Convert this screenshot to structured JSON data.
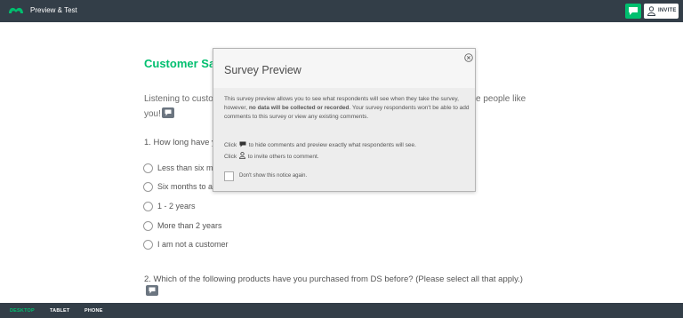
{
  "topbar": {
    "logo_icon": "surveymonkey-logo",
    "title": "Preview & Test",
    "comment_icon": "comment-icon",
    "invite_label": "INVITE"
  },
  "survey": {
    "title": "Customer Sat",
    "intro_left": "Listening to custom",
    "intro_right": "e people like",
    "intro_end": "you!",
    "question1": "1. How long have y",
    "options": [
      "Less than six mo",
      "Six months to a",
      "1 - 2 years",
      "More than 2 years",
      "I am not a customer"
    ],
    "question2": "2. Which of the following products have you purchased from DS before? (Please select all that apply.)"
  },
  "modal": {
    "title": "Survey Preview",
    "body_part1": "This survey preview allows you to see what respondents will see when they take the survey, however, ",
    "body_bold": "no data will be collected or recorded",
    "body_part2": ". Your survey respondents won't be able to add comments to this survey or view any existing comments.",
    "line1_before": "Click",
    "line1_after": "to hide comments and preview exactly what respondents will see.",
    "line2_before": "Click",
    "line2_after": "to invite others to comment.",
    "checkbox_label": "Don't show this notice again."
  },
  "bottombar": {
    "tabs": [
      "DESKTOP",
      "TABLET",
      "PHONE"
    ],
    "active_tab": "DESKTOP"
  },
  "colors": {
    "bar": "#333e48",
    "accent": "#00bf6f"
  }
}
